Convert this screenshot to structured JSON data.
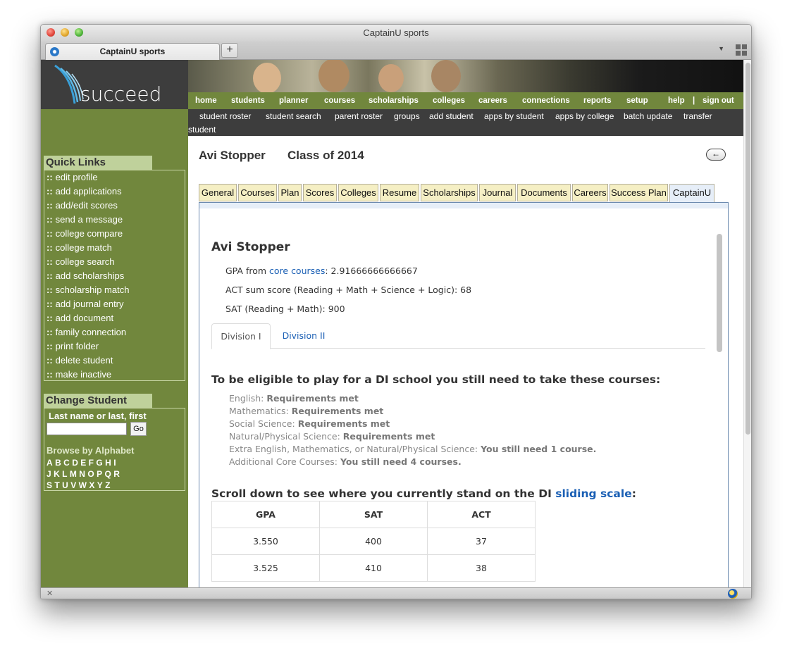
{
  "window": {
    "title": "CaptainU sports"
  },
  "browser_tab": {
    "label": "CaptainU sports",
    "new_tab": "+"
  },
  "logo": {
    "text": "succeed"
  },
  "main_nav": [
    "home",
    "students",
    "planner",
    "courses",
    "scholarships",
    "colleges",
    "careers",
    "connections",
    "reports",
    "setup",
    "help",
    "|",
    "sign out"
  ],
  "sub_nav": [
    "student roster",
    "student search",
    "parent roster",
    "groups",
    "add student",
    "apps by student",
    "apps by college",
    "batch update",
    "transfer",
    "student"
  ],
  "quick_links": {
    "heading": "Quick Links",
    "bullet": "::",
    "items": [
      "edit profile",
      "add applications",
      "add/edit scores",
      "send a message",
      "college compare",
      "college match",
      "college search",
      "add scholarships",
      "scholarship match",
      "add journal entry",
      "add document",
      "family connection",
      "print folder",
      "delete student",
      "make inactive"
    ]
  },
  "change_student": {
    "heading": "Change Student",
    "label": "Last name or last, first",
    "go": "Go",
    "browse_label": "Browse by Alphabet",
    "alphabet_rows": [
      [
        "A",
        "B",
        "C",
        "D",
        "E",
        "F",
        "G",
        "H",
        "I"
      ],
      [
        "J",
        "K",
        "L",
        "M",
        "N",
        "O",
        "P",
        "Q",
        "R"
      ],
      [
        "S",
        "T",
        "U",
        "V",
        "W",
        "X",
        "Y",
        "Z"
      ]
    ]
  },
  "student": {
    "name": "Avi Stopper",
    "class_of": "Class of 2014",
    "back": "←"
  },
  "tabs": [
    "General",
    "Courses",
    "Plan",
    "Scores",
    "Colleges",
    "Resume",
    "Scholarships",
    "Journal",
    "Documents",
    "Careers",
    "Success Plan",
    "CaptainU"
  ],
  "captainu": {
    "name": "Avi Stopper",
    "gpa_prefix": "GPA from ",
    "gpa_link": "core courses",
    "gpa_value": ": 2.91666666666667",
    "act_line": "ACT sum score (Reading + Math + Science + Logic): 68",
    "sat_line": "SAT (Reading + Math): 900",
    "division_tabs": [
      "Division I",
      "Division II"
    ],
    "eligibility_heading": "To be eligible to play for a DI school you still need to take these courses:",
    "requirements": [
      {
        "subject": "English: ",
        "status": "Requirements met"
      },
      {
        "subject": "Mathematics: ",
        "status": "Requirements met"
      },
      {
        "subject": "Social Science: ",
        "status": "Requirements met"
      },
      {
        "subject": "Natural/Physical Science: ",
        "status": "Requirements met"
      },
      {
        "subject": "Extra English, Mathematics, or Natural/Physical Science: ",
        "status": "You still need 1 course."
      },
      {
        "subject": "Additional Core Courses: ",
        "status": "You still need 4 courses."
      }
    ],
    "scale_prefix": "Scroll down to see where you currently stand on the DI ",
    "scale_link": "sliding scale",
    "scale_suffix": ":",
    "scale_table": {
      "headers": [
        "GPA",
        "SAT",
        "ACT"
      ],
      "rows": [
        [
          "3.550",
          "400",
          "37"
        ],
        [
          "3.525",
          "410",
          "38"
        ]
      ]
    }
  },
  "colors": {
    "sidebar_green": "#71873d",
    "dark_bar": "#3d3d3d",
    "tab_bg": "#f5efc4",
    "link_blue": "#1a5fb4"
  },
  "icons": [
    "close-traffic-light",
    "minimize-traffic-light",
    "maximize-traffic-light",
    "favicon-icon",
    "plus-icon",
    "chevron-down-icon",
    "grid-icon",
    "back-arrow-icon",
    "close-icon",
    "status-icon"
  ]
}
